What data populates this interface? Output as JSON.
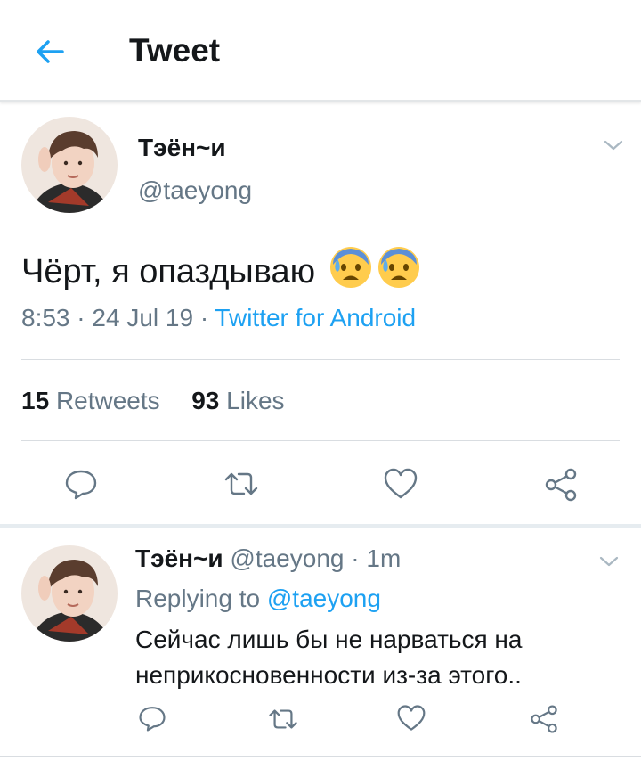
{
  "header": {
    "title": "Tweet"
  },
  "tweet": {
    "author_name": "Тэён~и",
    "author_handle": "@taeyong",
    "text": "Чёрт, я опаздываю",
    "time": "8:53",
    "date": "24 Jul 19",
    "source": "Twitter for Android",
    "retweets_count": "15",
    "retweets_label": "Retweets",
    "likes_count": "93",
    "likes_label": "Likes"
  },
  "reply": {
    "author_name": "Тэён~и",
    "author_handle": "@taeyong",
    "age": "1m",
    "replying_label": "Replying to",
    "replying_to": "@taeyong",
    "text": "Сейчас лишь бы не нарваться на неприкосновенности из-за этого.."
  },
  "icons": [
    "back-arrow-icon",
    "chevron-down-icon",
    "anxious-sweat-emoji",
    "reply-icon",
    "retweet-icon",
    "like-icon",
    "share-icon"
  ],
  "colors": {
    "accent": "#1da1f2",
    "secondary_text": "#657786",
    "divider": "#e6ecf0"
  }
}
